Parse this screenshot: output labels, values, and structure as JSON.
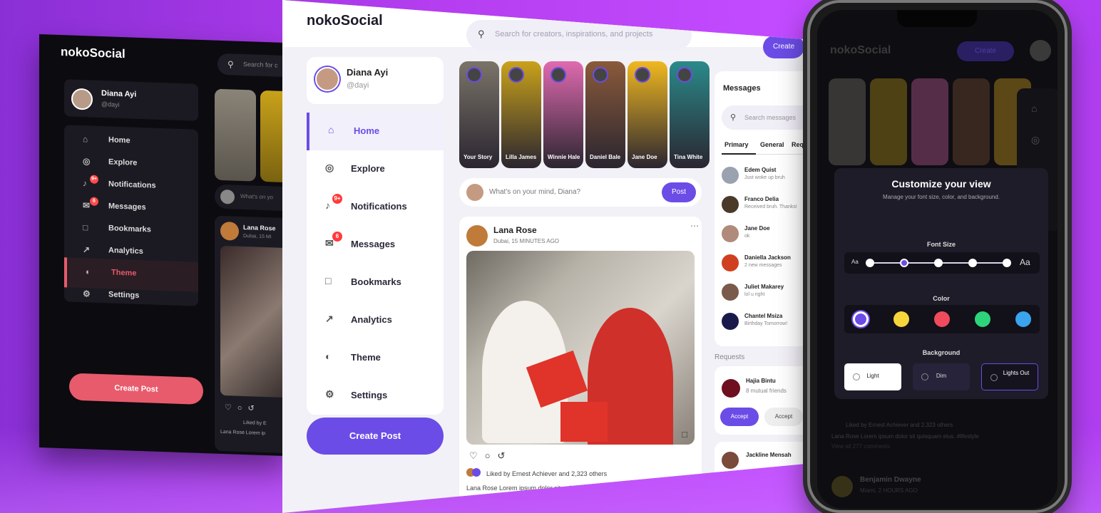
{
  "dark": {
    "logo": "nokoSocial",
    "search_placeholder": "Search for c",
    "profile": {
      "name": "Diana Ayi",
      "handle": "@dayi"
    },
    "menu": [
      {
        "label": "Home",
        "icon": "home-icon"
      },
      {
        "label": "Explore",
        "icon": "compass-icon"
      },
      {
        "label": "Notifications",
        "icon": "bell-icon",
        "badge": "9+"
      },
      {
        "label": "Messages",
        "icon": "envelope-icon",
        "badge": "6"
      },
      {
        "label": "Bookmarks",
        "icon": "bookmark-icon"
      },
      {
        "label": "Analytics",
        "icon": "chart-icon"
      },
      {
        "label": "Theme",
        "icon": "palette-icon",
        "active": true
      },
      {
        "label": "Settings",
        "icon": "gear-icon"
      }
    ],
    "create_post": "Create Post",
    "whats_on_mind": "What's on yo",
    "feed_name": "Lana Rose",
    "feed_loc": "Dubai, 15 MI",
    "liked_by": "Liked by E",
    "caption": "Lana Rose Lorem ip",
    "accent": "#e85b6c"
  },
  "win": {
    "logo": "nokoSocial",
    "search_placeholder": "Search for creators, inspirations, and projects",
    "create_top": "Create",
    "profile": {
      "name": "Diana Ayi",
      "handle": "@dayi"
    },
    "menu": [
      {
        "label": "Home",
        "icon": "home-icon",
        "active": true
      },
      {
        "label": "Explore",
        "icon": "compass-icon"
      },
      {
        "label": "Notifications",
        "icon": "bell-icon",
        "badge": "9+"
      },
      {
        "label": "Messages",
        "icon": "envelope-icon",
        "badge": "6"
      },
      {
        "label": "Bookmarks",
        "icon": "bookmark-icon"
      },
      {
        "label": "Analytics",
        "icon": "chart-icon"
      },
      {
        "label": "Theme",
        "icon": "palette-icon"
      },
      {
        "label": "Settings",
        "icon": "gear-icon"
      }
    ],
    "create_post": "Create Post",
    "stories": [
      {
        "label": "Your Story",
        "color": "#7a7468"
      },
      {
        "label": "Lilla James",
        "color": "#c9a21a"
      },
      {
        "label": "Winnie Hale",
        "color": "#e06ab0"
      },
      {
        "label": "Daniel Bale",
        "color": "#8a5a3a"
      },
      {
        "label": "Jane Doe",
        "color": "#f0b820"
      },
      {
        "label": "Tina White",
        "color": "#2a8a8a"
      }
    ],
    "whats_on_mind": "What's on your mind, Diana?",
    "post_btn": "Post",
    "feed": {
      "name": "Lana Rose",
      "loc": "Dubai, 15 MINUTES AGO",
      "liked_by": "Liked by Ernest Achiever and 2,323 others",
      "caption": "Lana Rose Lorem ipsum dolor sit quisquam eius. #lifestyle"
    },
    "messages": {
      "title": "Messages",
      "search_placeholder": "Search messages",
      "tabs": [
        "Primary",
        "General",
        "Requests"
      ],
      "rows": [
        {
          "name": "Edem Quist",
          "text": "Just woke up bruh",
          "color": "#9aa2b0"
        },
        {
          "name": "Franco Delia",
          "text": "Received bruh. Thanks!",
          "color": "#4a3a2a"
        },
        {
          "name": "Jane Doe",
          "text": "ok",
          "color": "#b08a7a"
        },
        {
          "name": "Daniella Jackson",
          "text": "2 new messages",
          "color": "#d04020"
        },
        {
          "name": "Juliet Makarey",
          "text": "lol u right",
          "color": "#7a5a4a"
        },
        {
          "name": "Chantel Msiza",
          "text": "Birthday Tomorrow!",
          "color": "#1a1a4a"
        }
      ]
    },
    "requests_label": "Requests",
    "request": {
      "name": "Hajia Bintu",
      "mutual": "8 mutual friends",
      "accept": "Accept",
      "decline": "Accept"
    },
    "request2": {
      "name": "Jackline Mensah"
    },
    "accent": "#6c4ce6"
  },
  "phone": {
    "logo": "nokoSocial",
    "create": "Create",
    "modal": {
      "title": "Customize your view",
      "subtitle": "Manage your font size, color, and background.",
      "font_size_label": "Font Size",
      "font_small": "Aa",
      "font_large": "Aa",
      "color_label": "Color",
      "colors": [
        "#6c4ce6",
        "#f6d43c",
        "#ef4b5c",
        "#2ed47a",
        "#3aa4ee"
      ],
      "background_label": "Background",
      "backgrounds": [
        {
          "label": "Light"
        },
        {
          "label": "Dim"
        },
        {
          "label": "Lights Out",
          "selected": true
        }
      ],
      "font_level": 0.25
    },
    "dim_feed": {
      "liked_by": "Liked by Ernest Achiever and 2,323 others",
      "caption": "Lana Rose Lorem ipsum dolor sit quisquam eius. #lifestyle",
      "view_all": "View all 277 comments",
      "next_name": "Benjamin Dwayne",
      "next_loc": "Miami, 2 HOURS AGO"
    }
  }
}
